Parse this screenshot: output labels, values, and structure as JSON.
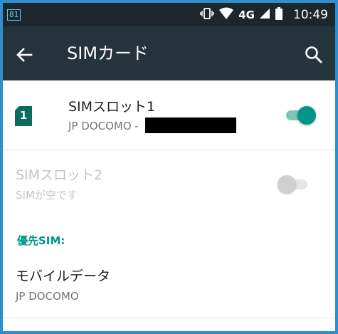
{
  "status_bar": {
    "notification_badge": "81",
    "network_label": "4G",
    "time": "10:49",
    "icons": [
      "vibrate-icon",
      "wifi-icon",
      "signal-icon",
      "battery-icon"
    ]
  },
  "app_bar": {
    "title": "SIMカード",
    "back_icon": "arrow-back-icon",
    "search_icon": "search-icon"
  },
  "sim_slots": [
    {
      "title": "SIMスロット1",
      "subtitle": "JP DOCOMO -",
      "badge": "1",
      "enabled": true,
      "toggle_on": true,
      "subtitle_redacted": true
    },
    {
      "title": "SIMスロット2",
      "subtitle": "SIMが空です",
      "enabled": false,
      "toggle_on": false
    }
  ],
  "preferred_sim": {
    "header": "優先SIM:",
    "items": [
      {
        "title": "モバイルデータ",
        "subtitle": "JP DOCOMO"
      }
    ]
  },
  "colors": {
    "status_bar": "#1c262b",
    "app_bar": "#25343b",
    "accent": "#009688",
    "sim_icon": "#0b6b5c",
    "frame_border": "#2d8fd0"
  }
}
